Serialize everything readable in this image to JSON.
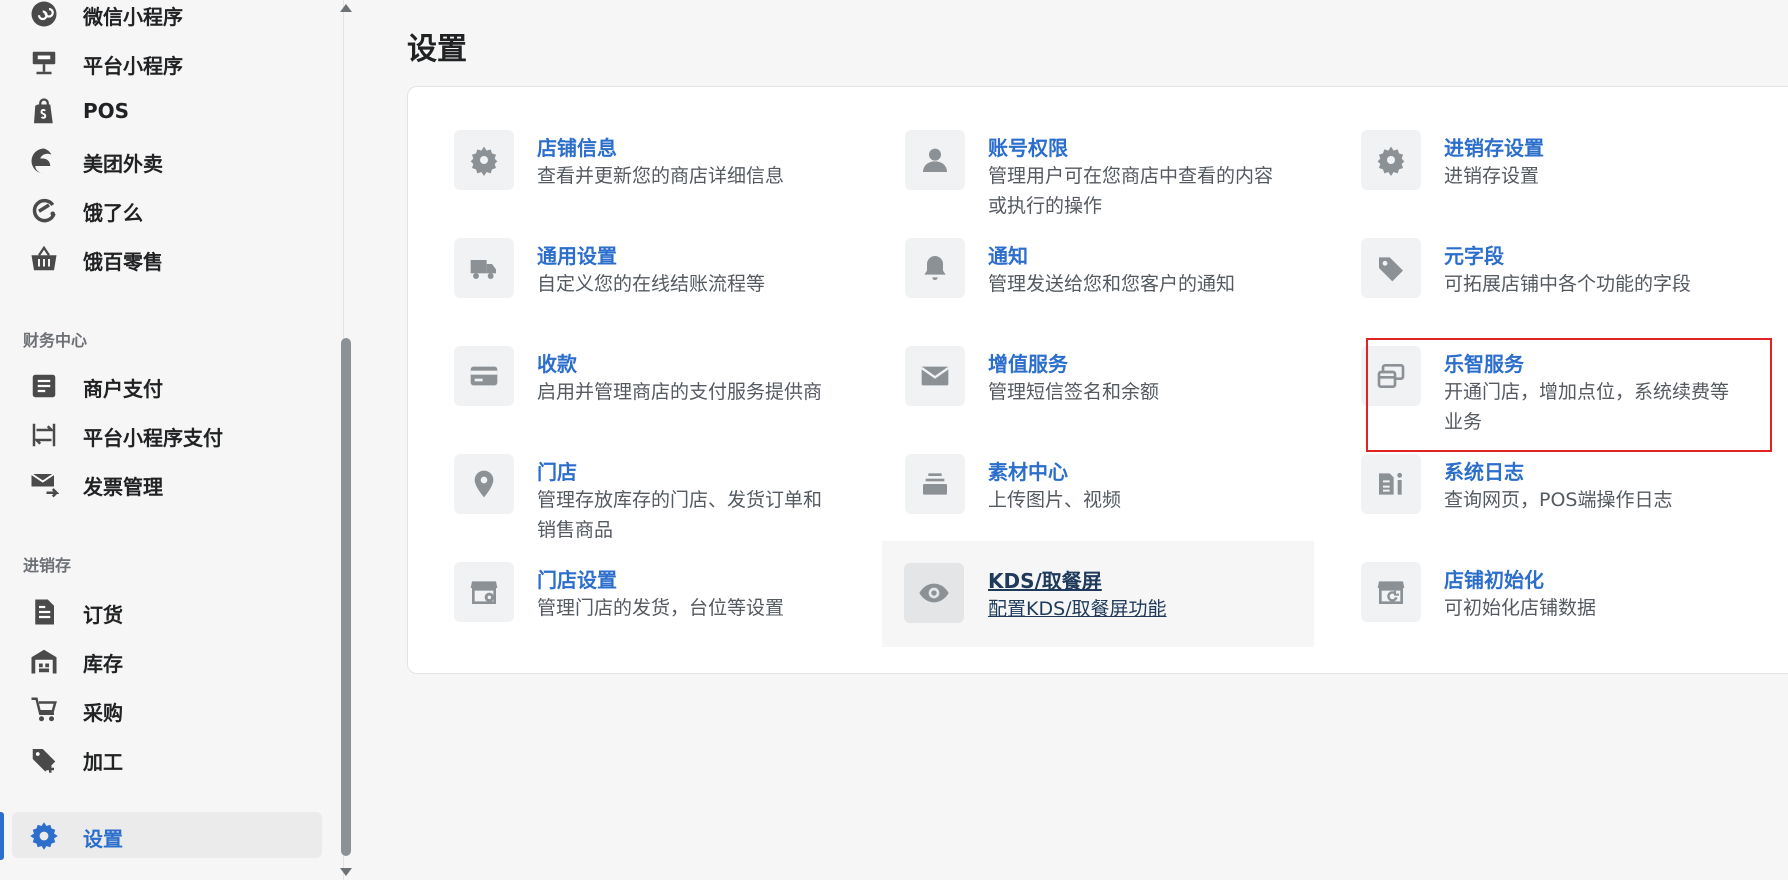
{
  "sidebar": {
    "items": [
      {
        "label": "微信小程序",
        "icon": "wechat-mini-program-icon"
      },
      {
        "label": "平台小程序",
        "icon": "platform-mini-program-icon"
      },
      {
        "label": "POS",
        "icon": "pos-bag-icon"
      },
      {
        "label": "美团外卖",
        "icon": "meituan-icon"
      },
      {
        "label": "饿了么",
        "icon": "eleme-icon"
      },
      {
        "label": "饿百零售",
        "icon": "basket-icon"
      }
    ],
    "finance_title": "财务中心",
    "finance_items": [
      {
        "label": "商户支付",
        "icon": "document-icon"
      },
      {
        "label": "平台小程序支付",
        "icon": "transfer-icon"
      },
      {
        "label": "发票管理",
        "icon": "mail-send-icon"
      }
    ],
    "inventory_title": "进销存",
    "inventory_items": [
      {
        "label": "订货",
        "icon": "file-icon"
      },
      {
        "label": "库存",
        "icon": "warehouse-icon"
      },
      {
        "label": "采购",
        "icon": "cart-icon"
      },
      {
        "label": "加工",
        "icon": "tag-plus-icon"
      }
    ],
    "settings_item": {
      "label": "设置",
      "icon": "gear-icon"
    }
  },
  "main": {
    "title": "设置",
    "settings": [
      {
        "title": "店铺信息",
        "desc": "查看并更新您的商店详细信息",
        "icon": "store-gear-icon"
      },
      {
        "title": "账号权限",
        "desc": "管理用户可在您商店中查看的内容或执行的操作",
        "icon": "user-icon"
      },
      {
        "title": "进销存设置",
        "desc": "进销存设置",
        "icon": "gear-icon"
      },
      {
        "title": "通用设置",
        "desc": "自定义您的在线结账流程等",
        "icon": "truck-icon"
      },
      {
        "title": "通知",
        "desc": "管理发送给您和您客户的通知",
        "icon": "bell-icon"
      },
      {
        "title": "元字段",
        "desc": "可拓展店铺中各个功能的字段",
        "icon": "tag-icon"
      },
      {
        "title": "收款",
        "desc": "启用并管理商店的支付服务提供商",
        "icon": "credit-card-icon"
      },
      {
        "title": "增值服务",
        "desc": "管理短信签名和余额",
        "icon": "envelope-icon"
      },
      {
        "title": "乐智服务",
        "desc": "开通门店，增加点位，系统续费等业务",
        "icon": "cards-icon"
      },
      {
        "title": "门店",
        "desc": "管理存放库存的门店、发货订单和销售商品",
        "icon": "location-icon"
      },
      {
        "title": "素材中心",
        "desc": "上传图片、视频",
        "icon": "stack-icon"
      },
      {
        "title": "系统日志",
        "desc": "查询网页，POS端操作日志",
        "icon": "log-icon"
      },
      {
        "title": "门店设置",
        "desc": "管理门店的发货，台位等设置",
        "icon": "store-settings-icon"
      },
      {
        "title": "KDS/取餐屏",
        "desc": "配置KDS/取餐屏功能",
        "icon": "eye-icon"
      },
      {
        "title": "店铺初始化",
        "desc": "可初始化店铺数据",
        "icon": "store-reset-icon"
      }
    ]
  },
  "colors": {
    "accent": "#2c6ecb",
    "highlight": "#e02424"
  }
}
